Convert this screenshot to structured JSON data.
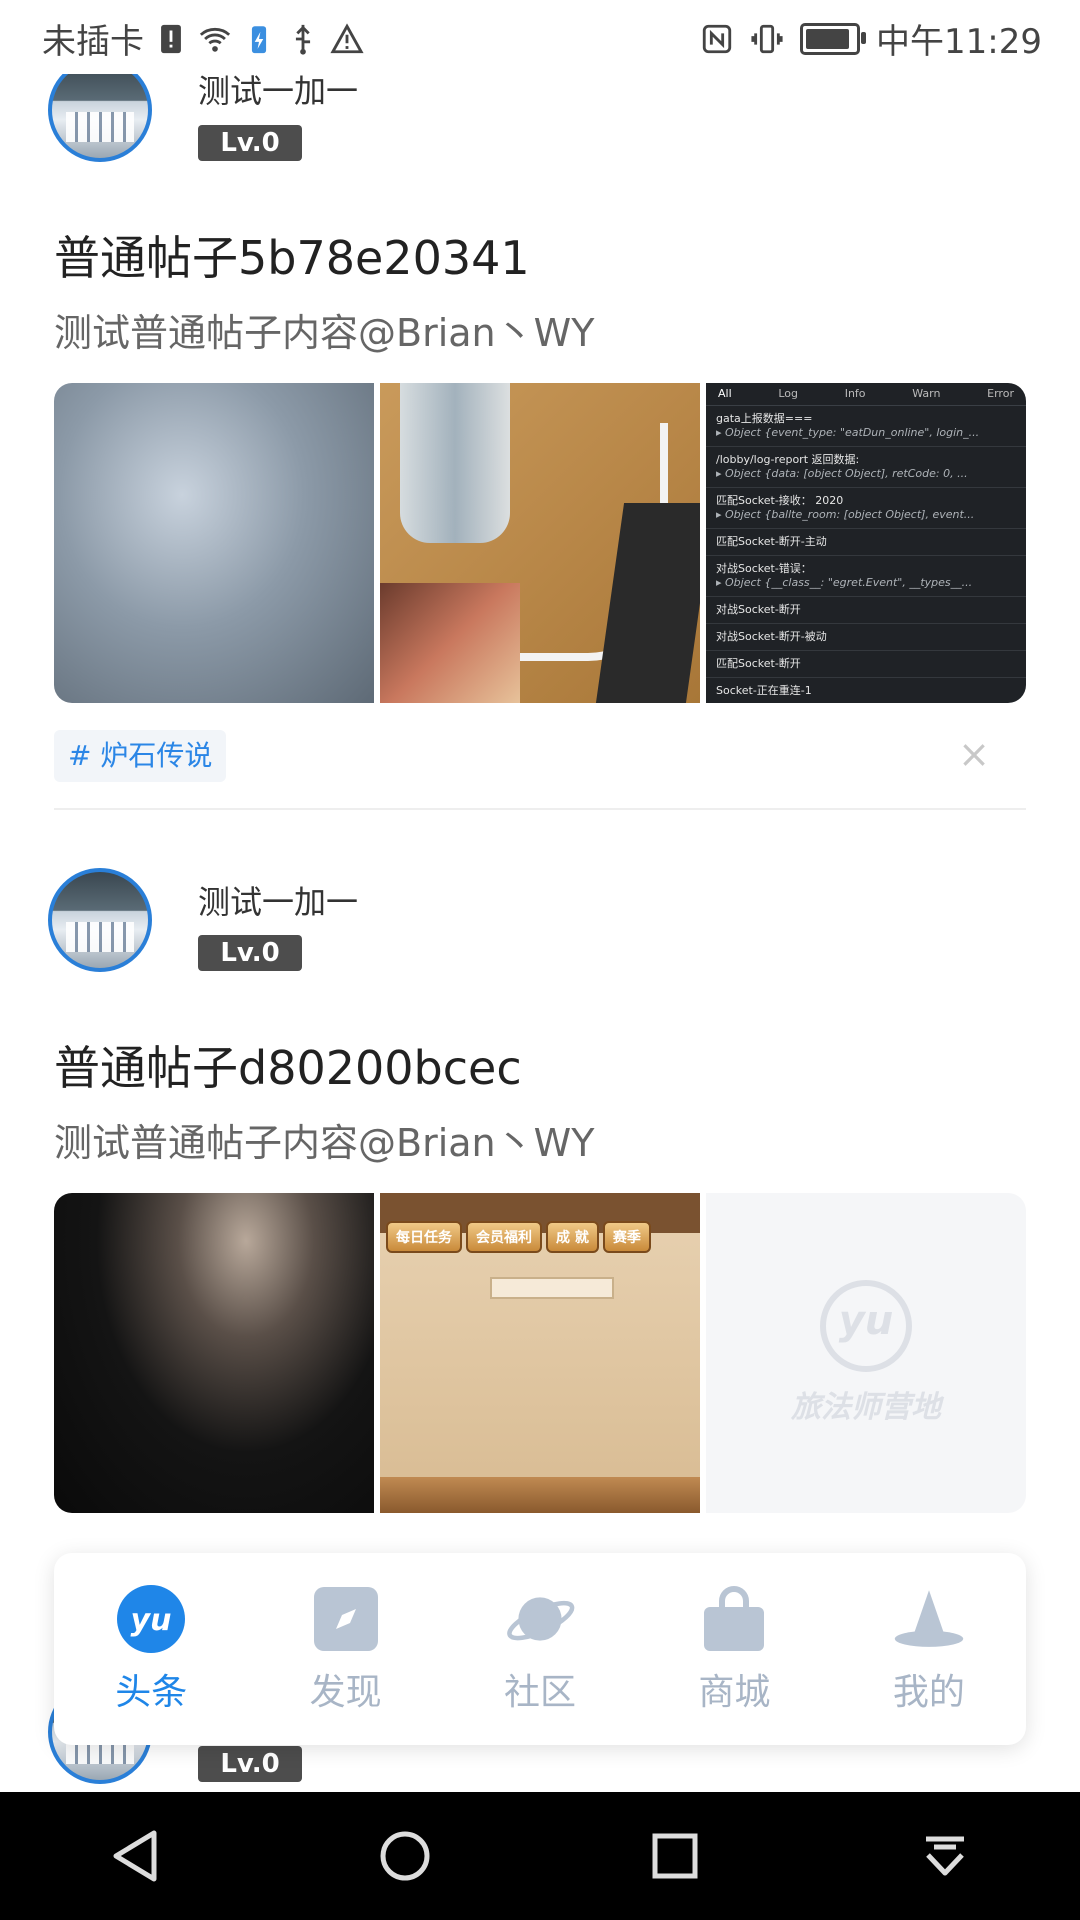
{
  "status_bar": {
    "carrier": "未插卡",
    "time": "中午11:29"
  },
  "posts": [
    {
      "username": "测试一加一",
      "level": "Lv.0",
      "title": "普通帖子5b78e20341",
      "content": "测试普通帖子内容@Brian丶WY",
      "tag": "# 炉石传说",
      "close": "×",
      "console": {
        "tabs": [
          "All",
          "Log",
          "Info",
          "Warn",
          "Error"
        ],
        "lines": [
          {
            "text": "gata上报数据===",
            "sub": "▸ Object {event_type: \"eatDun_online\", login_..."
          },
          {
            "text": "/lobby/log-report 返回数据:",
            "sub": "▸ Object {data: [object Object], retCode: 0, ..."
          },
          {
            "text": "匹配Socket-接收：  2020",
            "sub": "▸ Object {ballte_room: [object Object], event..."
          },
          {
            "text": "匹配Socket-断开-主动",
            "sub": ""
          },
          {
            "text": "对战Socket-错误：",
            "sub": "▸ Object {__class__: \"egret.Event\", __types__..."
          },
          {
            "text": "对战Socket-断开",
            "sub": ""
          },
          {
            "text": "对战Socket-断开-被动",
            "sub": ""
          },
          {
            "text": "匹配Socket-断开",
            "sub": ""
          },
          {
            "text": "Socket-正在重连-1",
            "sub": ""
          }
        ]
      }
    },
    {
      "username": "测试一加一",
      "level": "Lv.0",
      "title": "普通帖子d80200bcec",
      "content": "测试普通帖子内容@Brian丶WY",
      "game_buttons": [
        "每日任务",
        "会员福利",
        "成 就",
        "赛季"
      ],
      "placeholder_logo": "yu",
      "placeholder_text": "旅法师营地"
    },
    {
      "level": "Lv.0"
    }
  ],
  "tabbar": {
    "items": [
      {
        "label": "头条",
        "icon": "home-logo-icon",
        "active": true
      },
      {
        "label": "发现",
        "icon": "compass-icon",
        "active": false
      },
      {
        "label": "社区",
        "icon": "planet-icon",
        "active": false
      },
      {
        "label": "商城",
        "icon": "shopping-bag-icon",
        "active": false
      },
      {
        "label": "我的",
        "icon": "wizard-hat-icon",
        "active": false
      }
    ],
    "colors": {
      "active": "#1f86e8",
      "inactive": "#a8b5c6"
    }
  },
  "nav": [
    "back-icon",
    "home-circle-icon",
    "recents-icon",
    "notification-pull-icon"
  ]
}
